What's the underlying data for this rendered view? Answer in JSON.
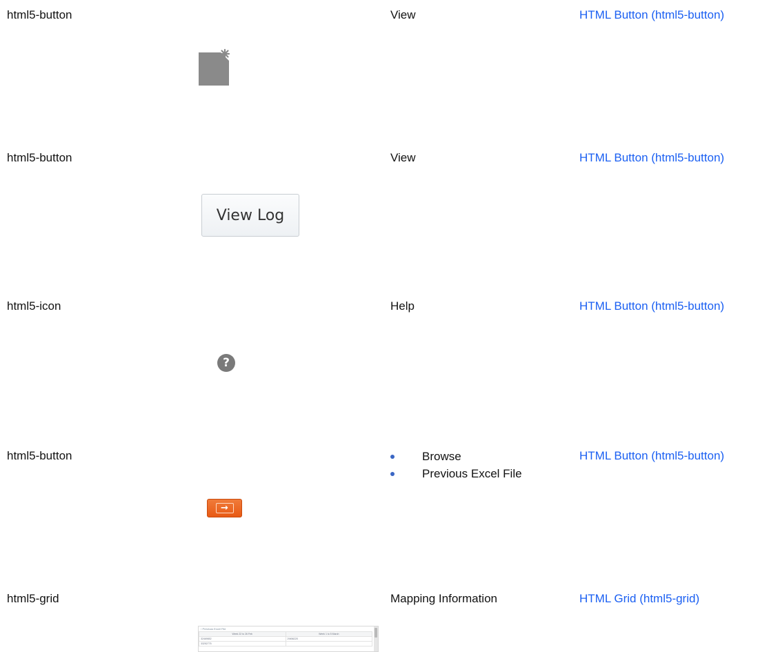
{
  "rows": [
    {
      "type": "html5-button",
      "caption": "View",
      "link": "HTML Button (html5-button)",
      "preview": {
        "kind": "icon",
        "icon": "file-icon"
      }
    },
    {
      "type": "html5-button",
      "caption": "View",
      "link": "HTML Button (html5-button)",
      "preview": {
        "kind": "button",
        "label": "View Log"
      }
    },
    {
      "type": "html5-icon",
      "caption": "Help",
      "link": "HTML Button (html5-button)",
      "preview": {
        "kind": "icon",
        "icon": "help-icon",
        "glyph": "?"
      }
    },
    {
      "type": "html5-button",
      "captions": [
        "Browse",
        "Previous Excel File"
      ],
      "link": "HTML Button (html5-button)",
      "preview": {
        "kind": "icon",
        "icon": "arrow-right-icon",
        "glyph": "→"
      }
    },
    {
      "type": "html5-grid",
      "caption": "Mapping Information",
      "link": "HTML Grid (html5-grid)",
      "preview": {
        "kind": "grid",
        "title": "› Previous Excel File",
        "headers": [
          "Week 22 to 26 Feb",
          "Week 1 to 5 March"
        ],
        "rows": [
          [
            "32469652",
            "29456220"
          ],
          [
            "33252775",
            ""
          ]
        ]
      }
    }
  ],
  "colors": {
    "link": "#1a5ff2",
    "bullet": "#3a66c4",
    "orange_button": "#e85a14",
    "help_icon": "#7a7a7a",
    "file_icon": "#8a8a8a"
  }
}
